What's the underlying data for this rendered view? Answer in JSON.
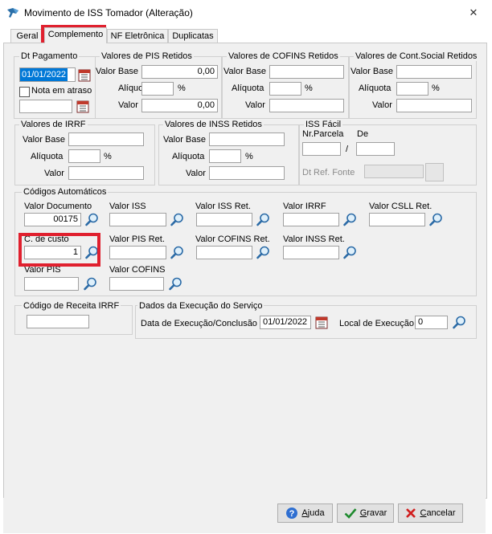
{
  "window": {
    "title": "Movimento de ISS Tomador (Alteração)",
    "close_glyph": "✕"
  },
  "tabs": [
    {
      "label": "Geral"
    },
    {
      "label": "Complemento"
    },
    {
      "label": "NF Eletrônica"
    },
    {
      "label": "Duplicatas"
    }
  ],
  "dt_pagamento": {
    "title": "Dt Pagamento",
    "value": "01/01/2022",
    "late_label": "Nota em atraso",
    "late_value": ""
  },
  "pis": {
    "title": "Valores de PIS Retidos",
    "base_label": "Valor Base",
    "base_value": "0,00",
    "rate_label": "Alíquota",
    "pct": "%",
    "value_label": "Valor",
    "value": "0,00"
  },
  "cofins": {
    "title": "Valores de COFINS Retidos",
    "base_label": "Valor Base",
    "rate_label": "Alíquota",
    "pct": "%",
    "value_label": "Valor"
  },
  "csll": {
    "title": "Valores de Cont.Social Retidos",
    "base_label": "Valor Base",
    "rate_label": "Alíquota",
    "pct": "%",
    "value_label": "Valor"
  },
  "irrf": {
    "title": "Valores de IRRF",
    "base_label": "Valor Base",
    "rate_label": "Alíquota",
    "pct": "%",
    "value_label": "Valor"
  },
  "inss": {
    "title": "Valores de INSS Retidos",
    "base_label": "Valor Base",
    "rate_label": "Alíquota",
    "pct": "%",
    "value_label": "Valor"
  },
  "iss_facil": {
    "title": "ISS Fácil",
    "parcela_label": "Nr.Parcela",
    "de_label": "De",
    "slash": "/",
    "ref_label": "Dt Ref. Fonte"
  },
  "codigos": {
    "title": "Códigos Automáticos",
    "valor_documento": {
      "label": "Valor Documento",
      "value": "00175"
    },
    "valor_iss": {
      "label": "Valor ISS"
    },
    "valor_iss_ret": {
      "label": "Valor ISS Ret."
    },
    "valor_irrf": {
      "label": "Valor IRRF"
    },
    "valor_csll_ret": {
      "label": "Valor CSLL Ret."
    },
    "c_de_custo": {
      "label": "C. de custo",
      "value": "1"
    },
    "valor_pis_ret": {
      "label": "Valor PIS Ret."
    },
    "valor_cofins_ret": {
      "label": "Valor COFINS Ret."
    },
    "valor_inss_ret": {
      "label": "Valor INSS Ret."
    },
    "valor_pis": {
      "label": "Valor PIS"
    },
    "valor_cofins": {
      "label": "Valor COFINS"
    }
  },
  "receita_irrf": {
    "title": "Código de Receita IRRF",
    "value": ""
  },
  "execucao": {
    "title": "Dados da Execução do Serviço",
    "date_label": "Data de Execução/Conclusão",
    "date_value": "01/01/2022",
    "local_label": "Local de Execução",
    "local_value": "0"
  },
  "buttons": {
    "ajuda": {
      "label_pre": "",
      "label_u": "A",
      "label_post": "juda"
    },
    "gravar": {
      "label_pre": "",
      "label_u": "G",
      "label_post": "ravar"
    },
    "cancelar": {
      "label_pre": "",
      "label_u": "C",
      "label_post": "ancelar"
    }
  },
  "colors": {
    "highlight": "#e0202e",
    "panel": "#f0f0f0",
    "selection": "#0078d7"
  }
}
